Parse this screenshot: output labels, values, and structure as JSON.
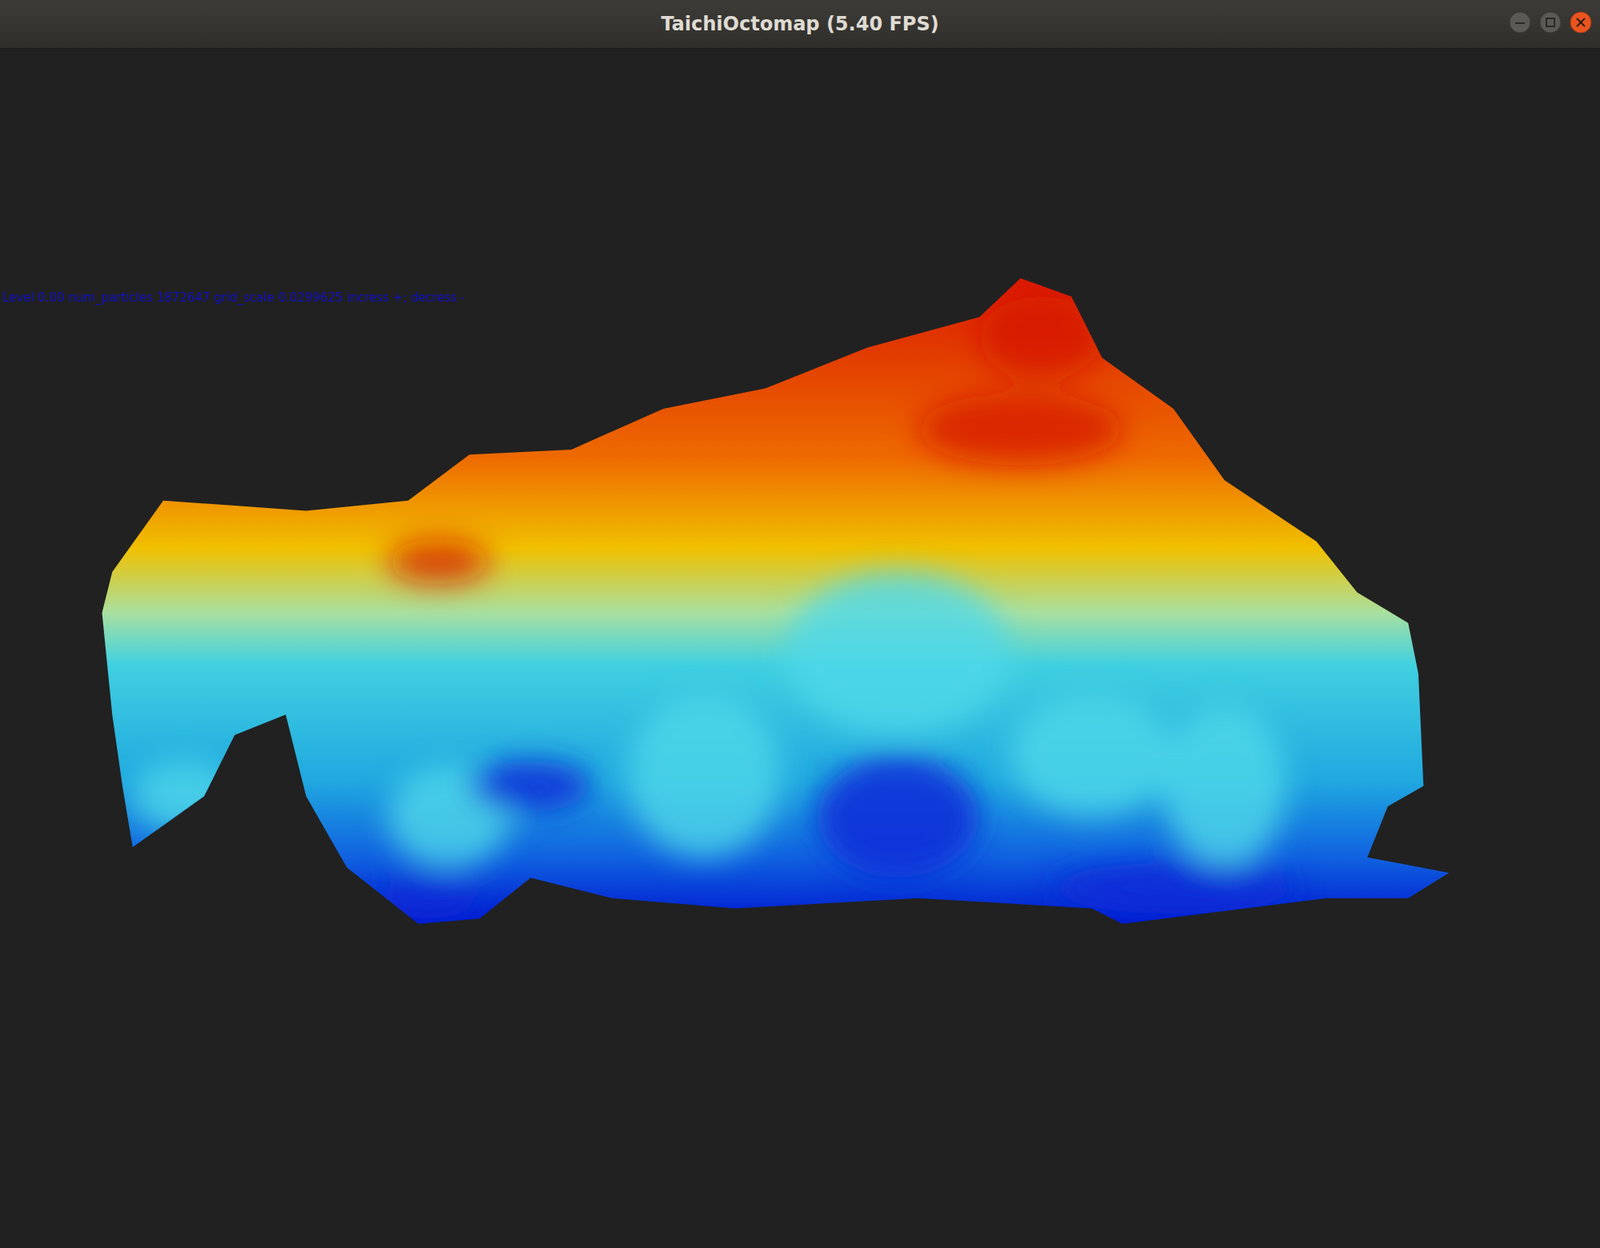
{
  "window": {
    "title": "TaichiOctomap (5.40 FPS)"
  },
  "overlay": {
    "text": "Level 0.00 num_particles 1872647 grid_scale 0.0299625 incress +; decress -"
  }
}
